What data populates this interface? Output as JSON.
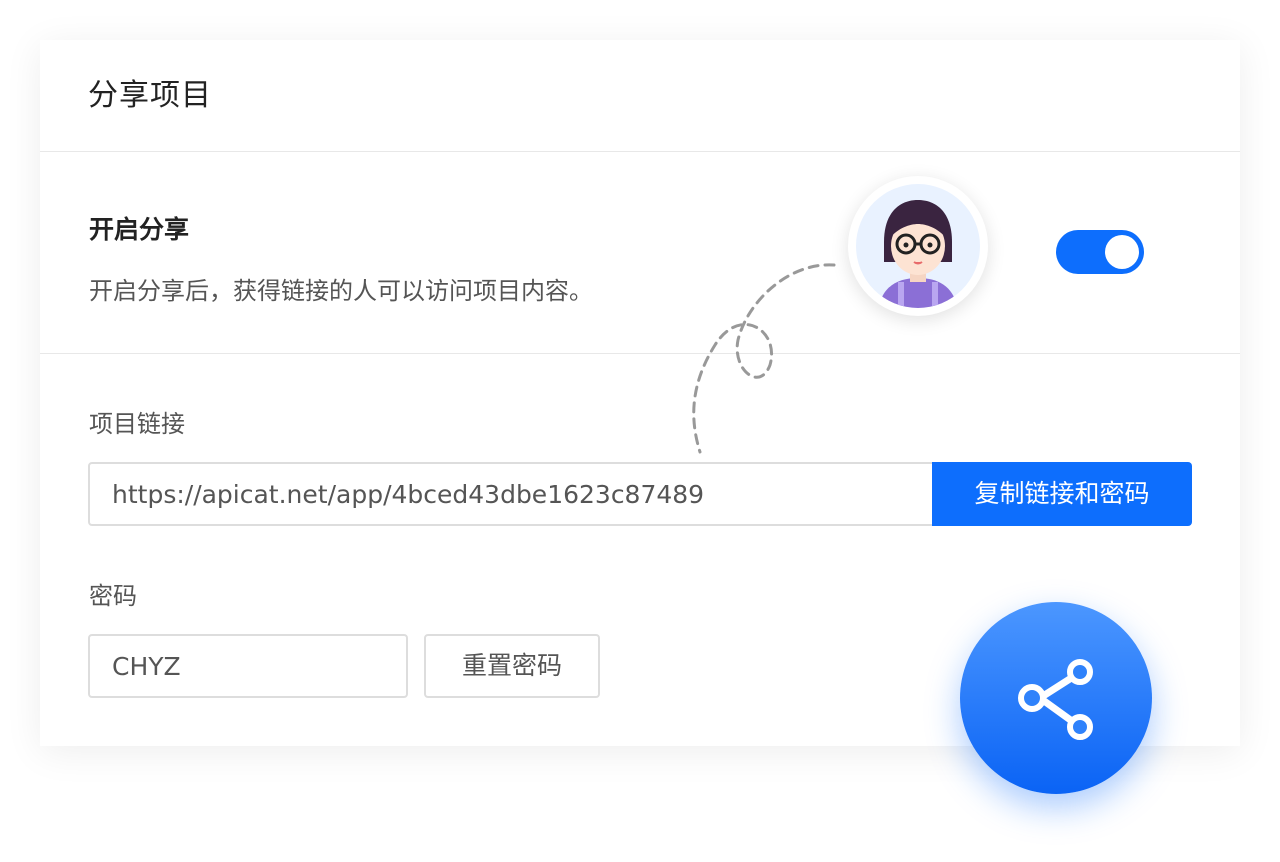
{
  "dialog": {
    "title": "分享项目"
  },
  "share": {
    "heading": "开启分享",
    "description": "开启分享后，获得链接的人可以访问项目内容。",
    "enabled": true
  },
  "link": {
    "label": "项目链接",
    "value": "https://apicat.net/app/4bced43dbe1623c87489",
    "copy_button_label": "复制链接和密码"
  },
  "password": {
    "label": "密码",
    "value": "CHYZ",
    "reset_button_label": "重置密码"
  },
  "decor": {
    "avatar_icon": "user-avatar-icon",
    "fab_icon": "share-icon"
  },
  "colors": {
    "primary": "#0d6efd",
    "text": "#222222",
    "muted": "#555555",
    "border": "#dddddd"
  }
}
